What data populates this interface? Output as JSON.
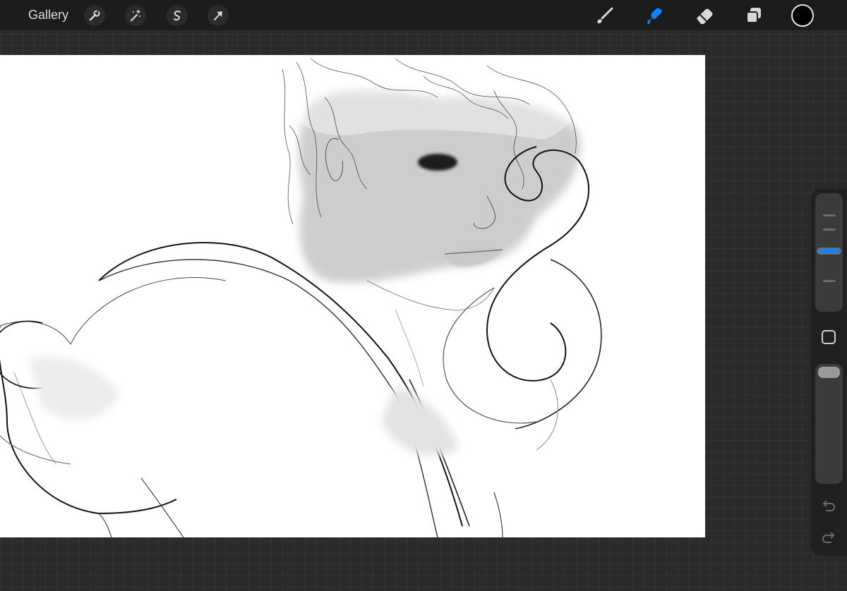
{
  "topbar": {
    "gallery_label": "Gallery",
    "left_tools": [
      "wrench-icon",
      "magic-wand-icon",
      "selection-s-icon",
      "transform-arrow-icon"
    ],
    "right_tools": [
      "brush-icon",
      "smudge-icon",
      "eraser-icon",
      "layers-icon"
    ],
    "active_tool": "smudge-icon",
    "current_color": "#000000",
    "accent_color": "#0A84FF"
  },
  "sidebar": {
    "brush_size_ticks": 4,
    "brush_size_active_tick": 3,
    "opacity_level": 1.0,
    "icons": [
      "modify-square-icon",
      "undo-icon",
      "redo-icon"
    ]
  }
}
